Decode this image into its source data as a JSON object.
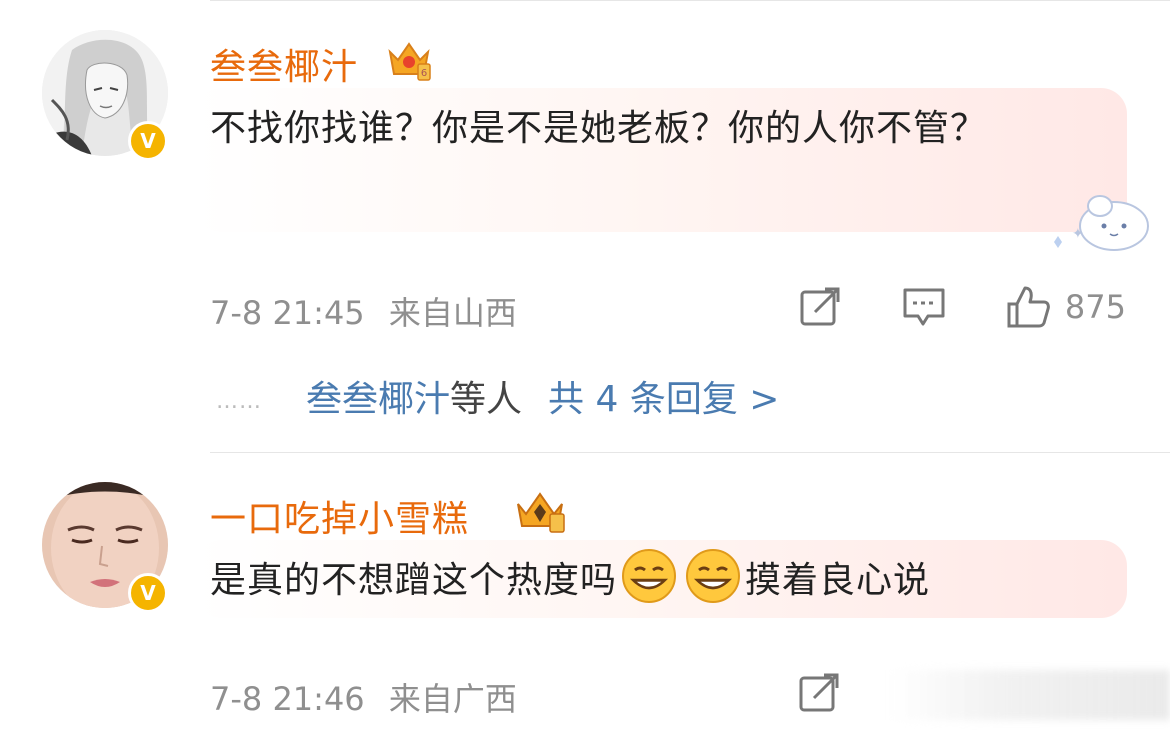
{
  "comments": [
    {
      "username": "叁叁椰汁",
      "text": "不找你找谁？你是不是她老板？你的人你不管？",
      "time": "7-8 21:45",
      "location": "来自山西",
      "likes": "875",
      "badge": "V",
      "replies": {
        "dots": "……",
        "name": "叁叁椰汁",
        "mid": "等人",
        "count": "共 4 条回复 >"
      }
    },
    {
      "username": "一口吃掉小雪糕",
      "text_part1": "是真的不想蹭这个热度吗",
      "text_part2": "摸着良心说",
      "time": "7-8 21:46",
      "location": "来自广西",
      "badge": "V"
    }
  ],
  "colors": {
    "username": "#e86a0c",
    "link": "#4a7bb0",
    "meta": "#8f8f8f",
    "badge": "#f5b400"
  },
  "icons": [
    "repost-icon",
    "comment-icon",
    "like-icon",
    "crown-icon",
    "grin-emoji-icon",
    "sticker-icon"
  ]
}
